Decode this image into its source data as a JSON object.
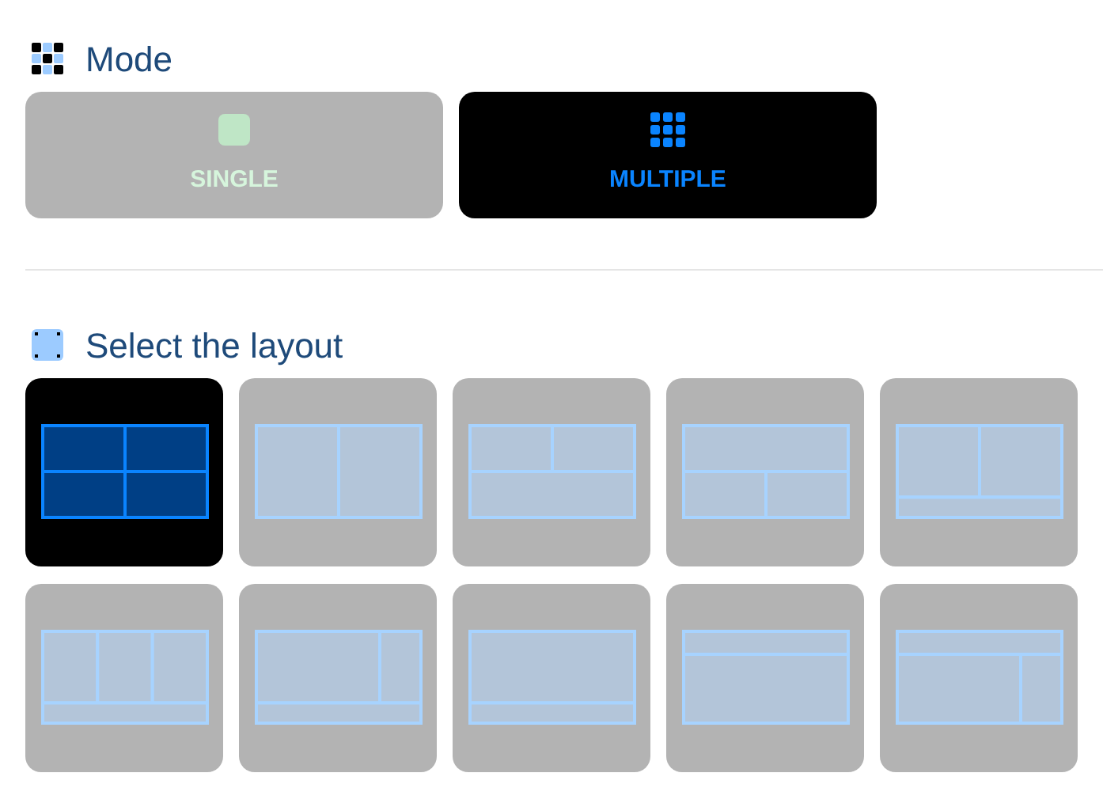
{
  "mode": {
    "title": "Mode",
    "options": [
      {
        "label": "SINGLE",
        "kind": "single",
        "selected": false
      },
      {
        "label": "MULTIPLE",
        "kind": "multiple",
        "selected": true
      }
    ]
  },
  "layout": {
    "title": "Select the layout",
    "options": [
      {
        "kind": "quad",
        "selected": true
      },
      {
        "kind": "halves",
        "selected": false
      },
      {
        "kind": "two-over-one",
        "selected": false
      },
      {
        "kind": "one-over-two",
        "selected": false
      },
      {
        "kind": "two-strip",
        "selected": false
      },
      {
        "kind": "three-strip",
        "selected": false
      },
      {
        "kind": "wide-narrow-strip",
        "selected": false
      },
      {
        "kind": "single-strip",
        "selected": false
      },
      {
        "kind": "strip-single",
        "selected": false
      },
      {
        "kind": "strip-wide-narrow",
        "selected": false
      }
    ]
  }
}
